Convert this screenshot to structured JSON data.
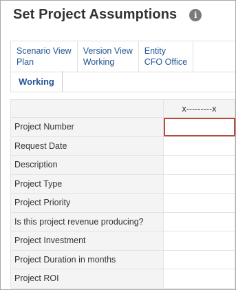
{
  "page": {
    "title": "Set Project Assumptions",
    "info_icon": "info-icon"
  },
  "pov": [
    {
      "dimension": "Scenario View",
      "member": "Plan"
    },
    {
      "dimension": "Version View",
      "member": "Working"
    },
    {
      "dimension": "Entity",
      "member": "CFO Office"
    }
  ],
  "tabs": [
    {
      "label": "Working",
      "active": true
    }
  ],
  "grid": {
    "column_header": "x---------x",
    "rows": [
      {
        "label": "Project Number",
        "value": ""
      },
      {
        "label": "Request Date",
        "value": ""
      },
      {
        "label": "Description",
        "value": ""
      },
      {
        "label": "Project Type",
        "value": ""
      },
      {
        "label": "Project Priority",
        "value": ""
      },
      {
        "label": "Is this project revenue producing?",
        "value": ""
      },
      {
        "label": "Project Investment",
        "value": ""
      },
      {
        "label": "Project Duration in months",
        "value": ""
      },
      {
        "label": "Project ROI",
        "value": ""
      }
    ],
    "selected_row": 0
  },
  "colors": {
    "link": "#1f5493",
    "selection": "#b94a3a",
    "label_bg": "#f4f4f4"
  }
}
